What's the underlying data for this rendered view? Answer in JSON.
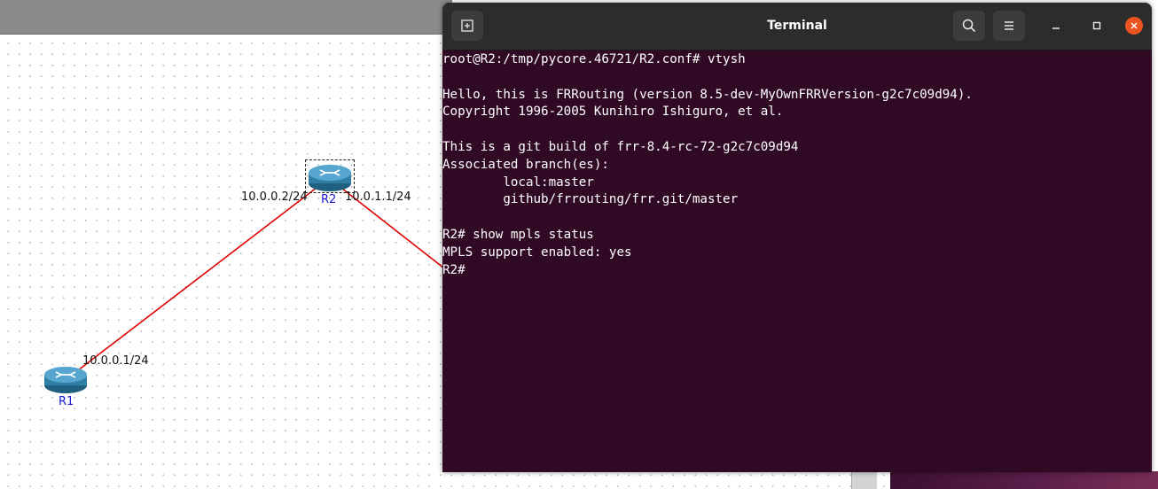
{
  "canvas": {
    "nodes": [
      {
        "name": "R1"
      },
      {
        "name": "R2"
      }
    ],
    "interfaces": {
      "r1_eth0": "10.0.0.1/24",
      "r2_eth0": "10.0.0.2/24",
      "r2_eth1": "10.0.1.1/24"
    },
    "link_color": "#e00000",
    "router_color": "#3b8fb3"
  },
  "terminal": {
    "title": "Terminal",
    "background": "#300a24",
    "close_color": "#e95420",
    "lines": [
      "root@R2:/tmp/pycore.46721/R2.conf# vtysh",
      "",
      "Hello, this is FRRouting (version 8.5-dev-MyOwnFRRVersion-g2c7c09d94).",
      "Copyright 1996-2005 Kunihiro Ishiguro, et al.",
      "",
      "This is a git build of frr-8.4-rc-72-g2c7c09d94",
      "Associated branch(es):",
      "        local:master",
      "        github/frrouting/frr.git/master",
      "",
      "R2# show mpls status",
      "MPLS support enabled: yes",
      "R2#"
    ]
  }
}
